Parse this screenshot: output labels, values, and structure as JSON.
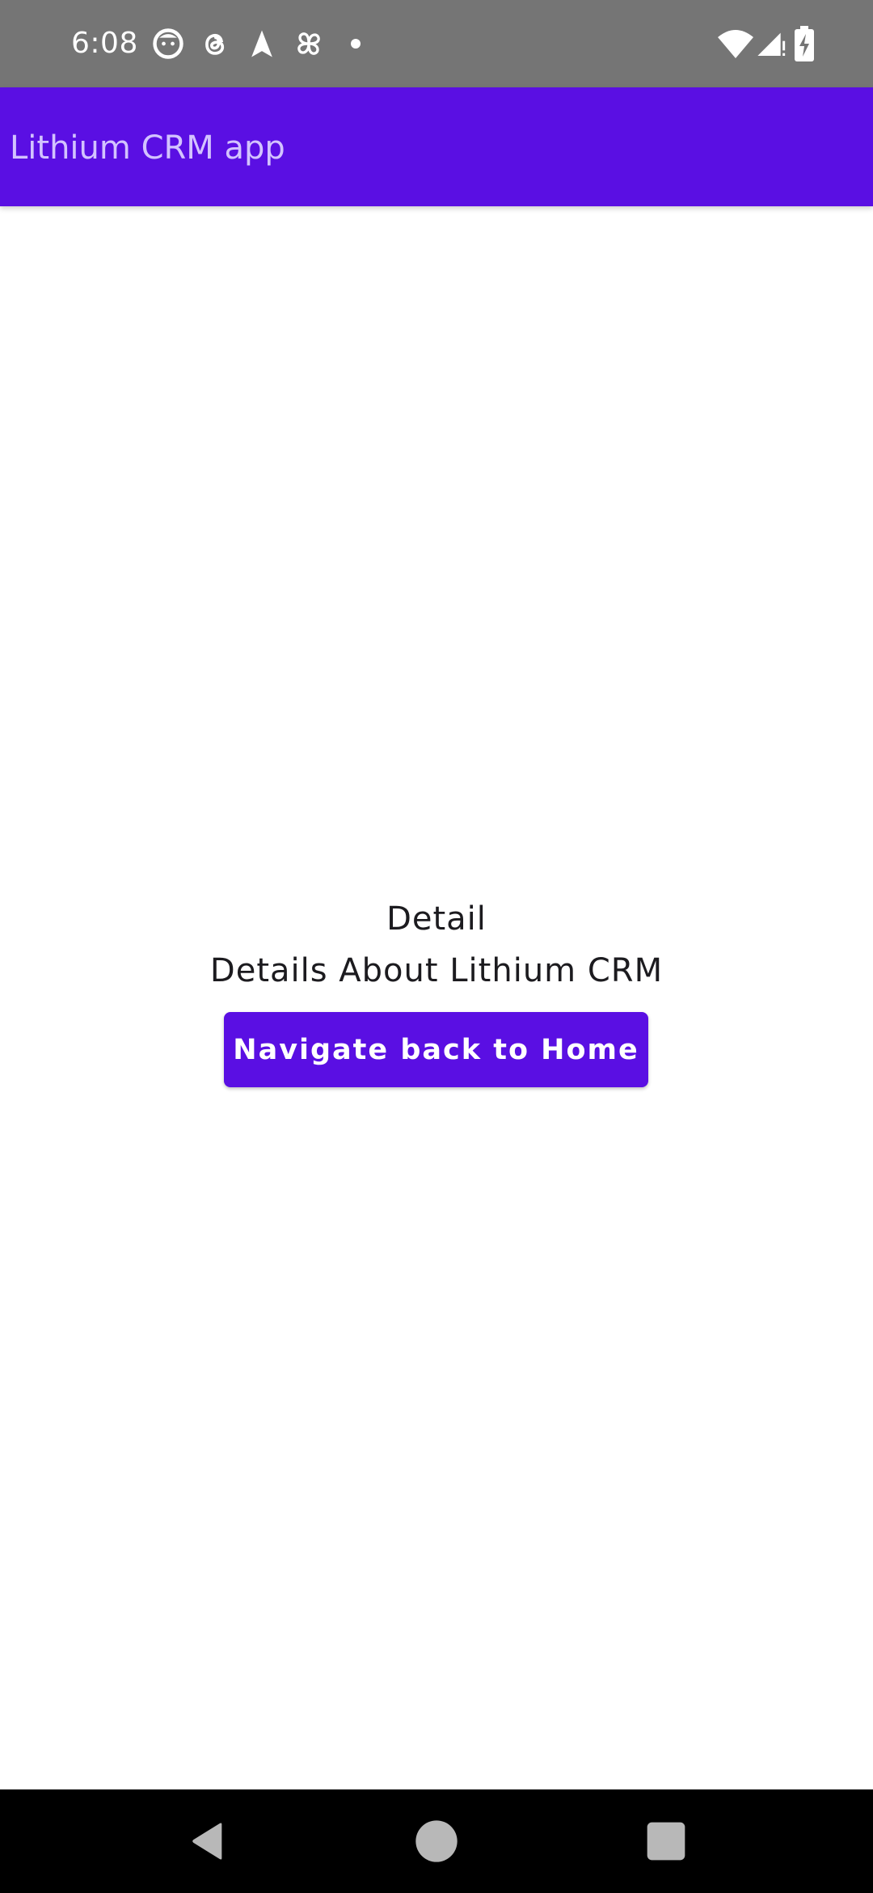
{
  "status_bar": {
    "time": "6:08",
    "left_icons": [
      "face-notification-icon",
      "threads-icon",
      "navigation-arrow-icon",
      "pinwheel-icon",
      "dot-icon"
    ],
    "right_icons": [
      "wifi-icon",
      "signal-icon",
      "battery-charging-icon"
    ]
  },
  "app_bar": {
    "title": "Lithium CRM app",
    "background": "#5a0fe3",
    "title_color": "#d3c3ff"
  },
  "content": {
    "heading": "Detail",
    "subtitle": "Details About Lithium CRM",
    "button_label": "Navigate back to Home"
  },
  "nav_bar": {
    "buttons": [
      "back-icon",
      "home-icon",
      "recents-icon"
    ]
  }
}
